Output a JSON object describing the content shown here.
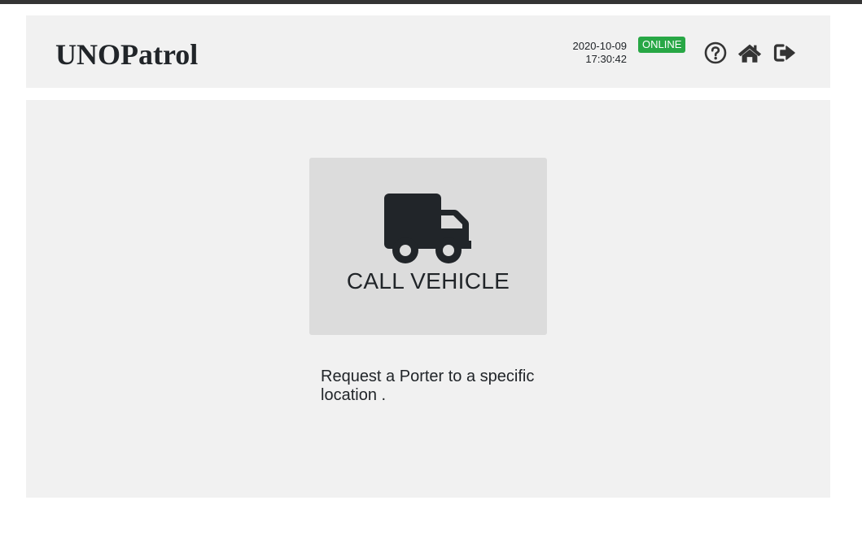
{
  "header": {
    "app_title": "UNOPatrol",
    "date": "2020-10-09",
    "time": "17:30:42",
    "status": "ONLINE",
    "status_color": "#28a745",
    "icons": [
      "help-icon",
      "home-icon",
      "logout-icon"
    ]
  },
  "main": {
    "tile": {
      "icon": "truck-icon",
      "label": "CALL VEHICLE"
    },
    "description": "Request a Porter to a specific location ."
  }
}
